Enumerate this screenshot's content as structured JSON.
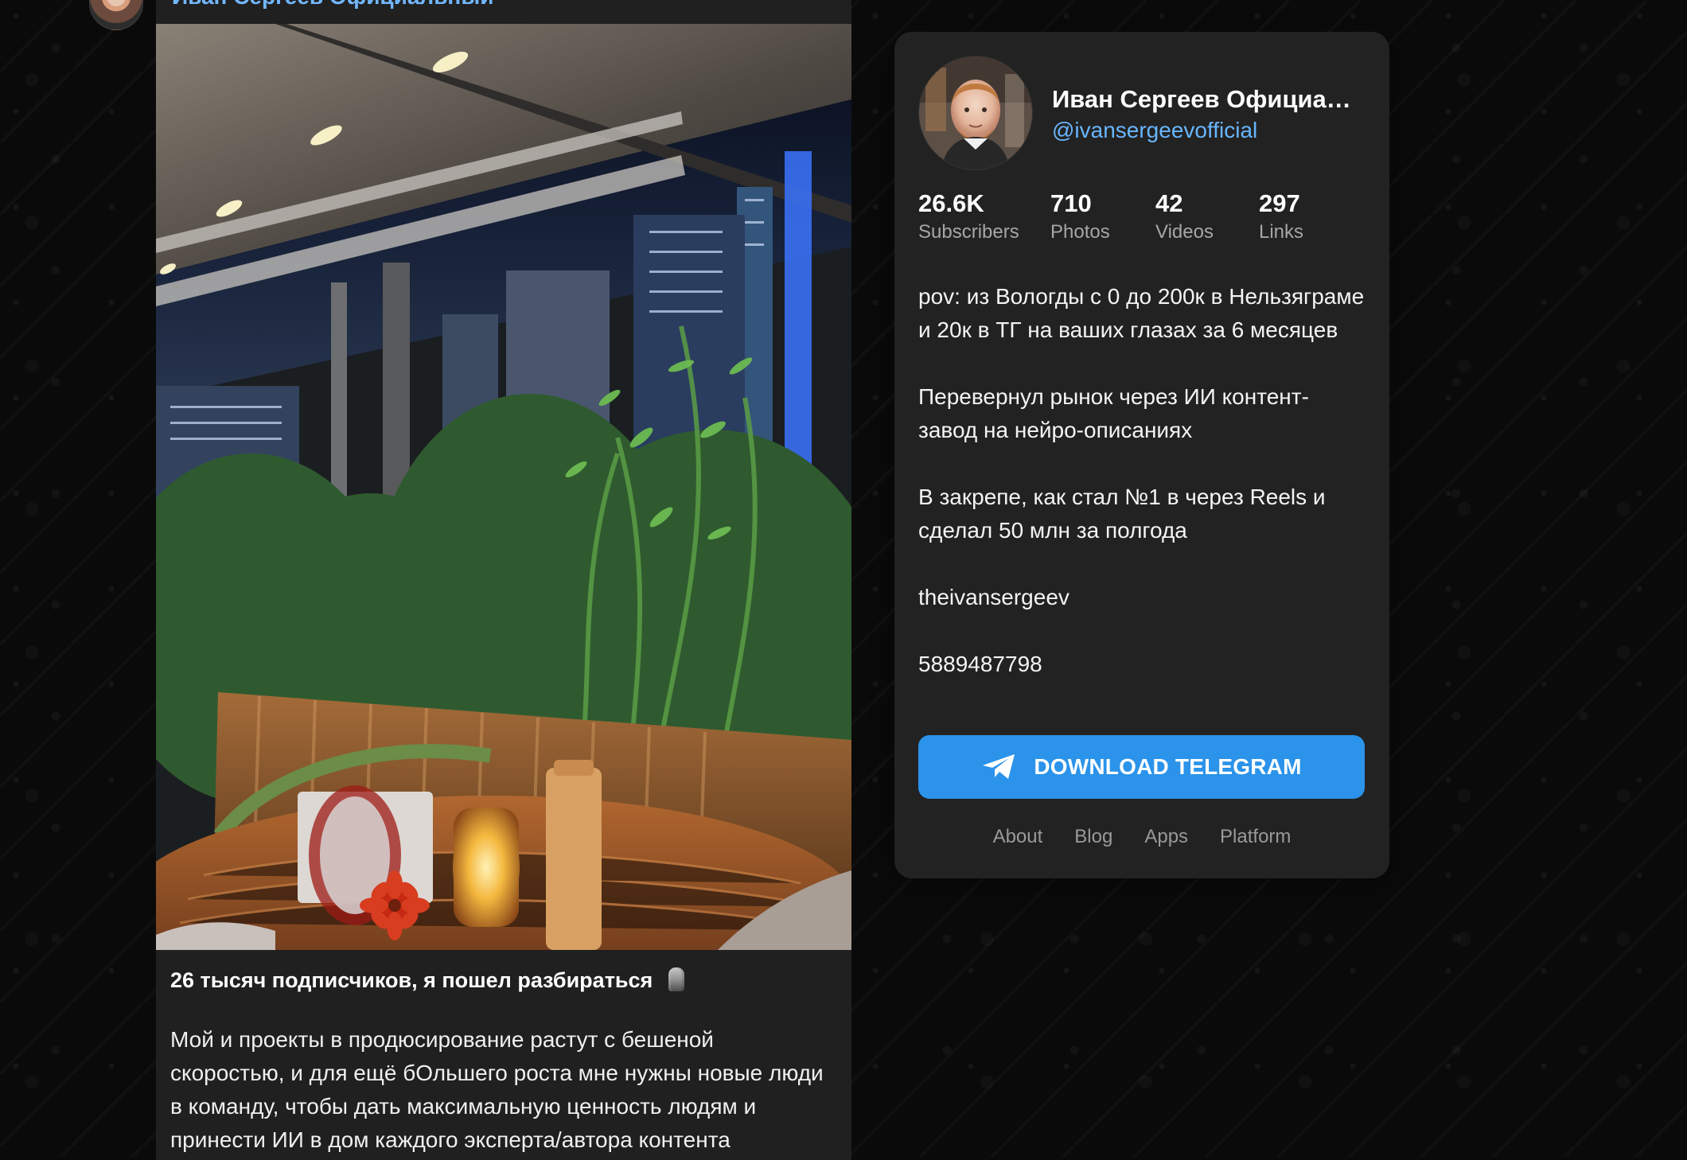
{
  "post": {
    "author_name": "Иван Сергеев Официальный",
    "title": "26 тысяч подписчиков, я пошел разбираться",
    "body": "Мой и проекты в продюсирование растут с бешеной\nскоростью, и для ещё бОльшего роста мне нужны новые люди\nв команду, чтобы дать максимальную ценность людям и\nпринести ИИ в дом каждого эксперта/автора контента"
  },
  "channel": {
    "title": "Иван Сергеев Официаль...",
    "username": "@ivansergeevofficial",
    "stats": [
      {
        "value": "26.6K",
        "label": "Subscribers"
      },
      {
        "value": "710",
        "label": "Photos"
      },
      {
        "value": "42",
        "label": "Videos"
      },
      {
        "value": "297",
        "label": "Links"
      }
    ],
    "description": [
      "pov: из Вологды с 0 до 200к в Нельзяграме и 20к в ТГ на ваших глазах за 6 месяцев",
      "Перевернул рынок через ИИ контент-завод на нейро-описаниях",
      "В закрепе, как стал №1 в через Reels и сделал 50 млн за полгода",
      "theivansergeev",
      "5889487798"
    ],
    "download_label": "DOWNLOAD TELEGRAM",
    "footer_links": [
      "About",
      "Blog",
      "Apps",
      "Platform"
    ]
  },
  "colors": {
    "background": "#0a0a0a",
    "card": "#222222",
    "post_card": "#202020",
    "accent": "#2b93ea",
    "link": "#68b6ff"
  },
  "icons": {
    "telegram": "paper-plane-icon",
    "post_title_emoji": "stone-moai-icon"
  }
}
